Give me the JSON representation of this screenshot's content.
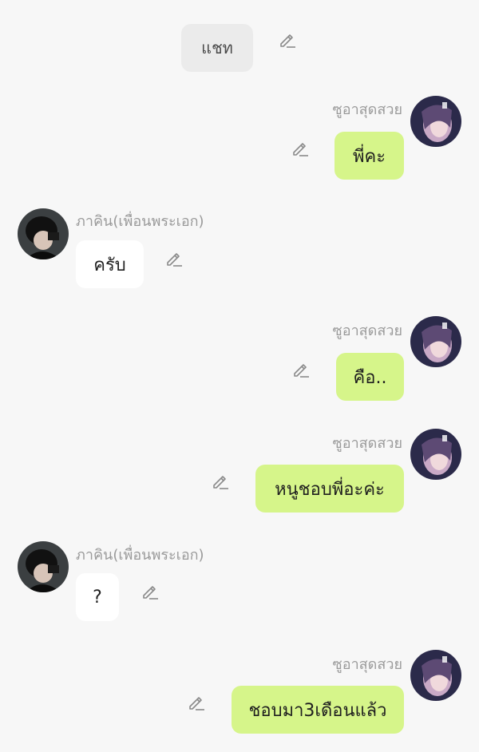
{
  "system": {
    "label": "แชท"
  },
  "users": {
    "me": {
      "name": "ซูอาสุดสวย"
    },
    "other": {
      "name": "ภาคิน(เพื่อนพระเอก)"
    }
  },
  "messages": [
    {
      "sender": "me",
      "text": "พี่คะ"
    },
    {
      "sender": "other",
      "text": "ครับ"
    },
    {
      "sender": "me",
      "text": "คือ.."
    },
    {
      "sender": "me",
      "text": "หนูชอบพี่อะค่ะ"
    },
    {
      "sender": "other",
      "text": "?"
    },
    {
      "sender": "me",
      "text": "ชอบมา3เดือนแล้ว"
    }
  ],
  "colors": {
    "background": "#f7f7f7",
    "my_bubble": "#d6f58a",
    "other_bubble": "#ffffff",
    "name_text": "#9a9a9a"
  },
  "icons": {
    "edit": "pencil-icon"
  }
}
